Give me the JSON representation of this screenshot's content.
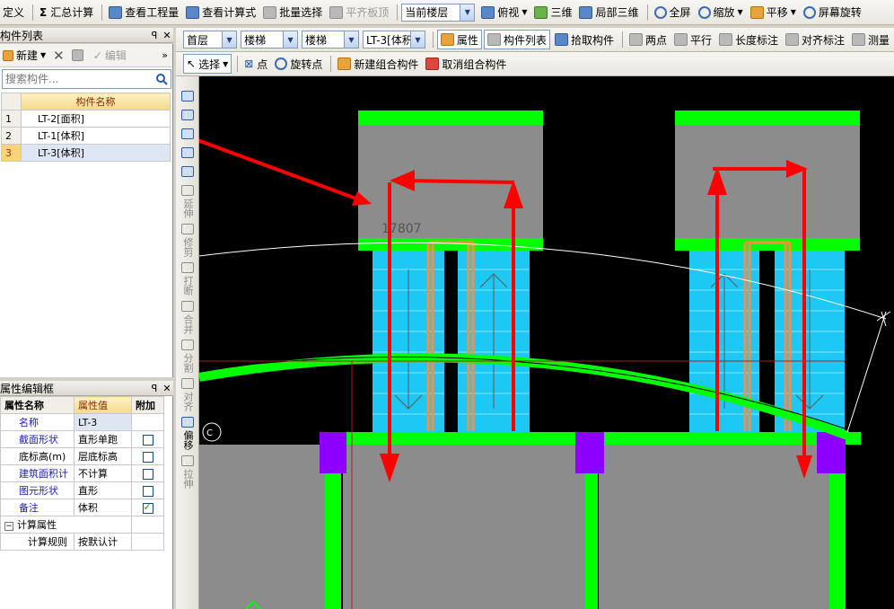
{
  "toolbar1": {
    "items": [
      {
        "label": "定义",
        "icon": "define-icon"
      },
      {
        "label": "汇总计算",
        "icon": "sigma-icon"
      },
      {
        "label": "查看工程量",
        "icon": "view-quantity-icon"
      },
      {
        "label": "查看计算式",
        "icon": "view-formula-icon"
      },
      {
        "label": "批量选择",
        "icon": "batch-select-icon"
      },
      {
        "label": "平齐板顶",
        "icon": "align-slab-top-icon"
      },
      {
        "label": "当前楼层",
        "icon": "floor-icon"
      },
      {
        "label": "俯视",
        "icon": "top-view-icon"
      },
      {
        "label": "三维",
        "icon": "3d-icon"
      },
      {
        "label": "局部三维",
        "icon": "local-3d-icon"
      },
      {
        "label": "全屏",
        "icon": "fullscreen-icon"
      },
      {
        "label": "缩放",
        "icon": "zoom-icon"
      },
      {
        "label": "平移",
        "icon": "pan-icon"
      },
      {
        "label": "屏幕旋转",
        "icon": "rotate-screen-icon"
      }
    ]
  },
  "toolbar2": {
    "combos": [
      "首层",
      "楼梯",
      "楼梯",
      "LT-3[体积"
    ],
    "items": [
      {
        "label": "属性"
      },
      {
        "label": "构件列表"
      },
      {
        "label": "拾取构件"
      },
      {
        "label": "两点"
      },
      {
        "label": "平行"
      },
      {
        "label": "长度标注"
      },
      {
        "label": "对齐标注"
      },
      {
        "label": "测量"
      }
    ]
  },
  "toolbar3": {
    "items": [
      {
        "label": "选择"
      },
      {
        "label": "点"
      },
      {
        "label": "旋转点"
      },
      {
        "label": "新建组合构件"
      },
      {
        "label": "取消组合构件"
      }
    ]
  },
  "component_list": {
    "title": "构件列表",
    "new_label": "新建",
    "edit_label": "编辑",
    "search_placeholder": "搜索构件...",
    "column_header": "构件名称",
    "rows": [
      {
        "num": "1",
        "name": "LT-2[面积]"
      },
      {
        "num": "2",
        "name": "LT-1[体积]"
      },
      {
        "num": "3",
        "name": "LT-3[体积]"
      }
    ]
  },
  "property_panel": {
    "title": "属性编辑框",
    "headers": [
      "属性名称",
      "属性值",
      "附加"
    ],
    "rows": [
      {
        "name": "名称",
        "value": "LT-3",
        "check": null
      },
      {
        "name": "截面形状",
        "value": "直形单跑",
        "check": false
      },
      {
        "name": "底标高(m)",
        "value": "层底标高",
        "check": false
      },
      {
        "name": "建筑面积计",
        "value": "不计算",
        "check": false
      },
      {
        "name": "图元形状",
        "value": "直形",
        "check": false
      },
      {
        "name": "备注",
        "value": "体积",
        "check": true
      }
    ],
    "group_label": "计算属性",
    "group_rows": [
      {
        "name": "计算规则",
        "value": "按默认计"
      }
    ]
  },
  "vertical_tools": [
    {
      "label": "延伸"
    },
    {
      "label": "修剪"
    },
    {
      "label": "打断"
    },
    {
      "label": "合并"
    },
    {
      "label": "分割"
    },
    {
      "label": "对齐"
    },
    {
      "label": "偏移"
    },
    {
      "label": "拉伸"
    }
  ],
  "canvas": {
    "dimension_text": "17807"
  },
  "colors": {
    "slab_green": "#00ff00",
    "stair_gray": "#8c8c8c",
    "stair_cyan": "#1ec8f5",
    "column_purple": "#8b00ff",
    "arrow_red": "#ff0000",
    "trace_orange": "#ff8c3c"
  }
}
